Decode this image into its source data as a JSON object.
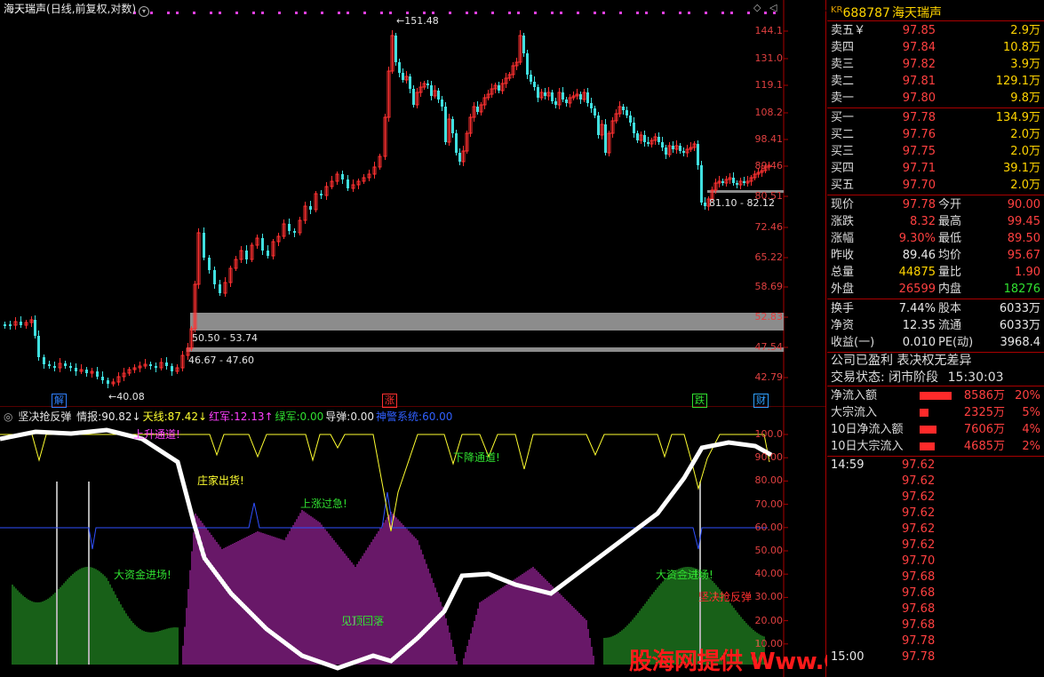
{
  "chart_header": {
    "stock_name": "海天瑞声",
    "mode": "(日线,前复权,对数)"
  },
  "price_axis": [
    "144.1",
    "131.0",
    "119.1",
    "108.2",
    "98.41",
    "89.46",
    "80.51",
    "72.46",
    "65.22",
    "58.69",
    "52.83",
    "47.54",
    "42.79"
  ],
  "price_annotations": {
    "high": "151.48",
    "low": "40.08",
    "zone_upper": "50.50 - 53.74",
    "zone_lower": "46.67 - 47.60",
    "gap_zone": "81.10 - 82.12"
  },
  "event_tags": [
    {
      "label": "解",
      "color": "#3080ff"
    },
    {
      "label": "涨",
      "color": "#ff3030"
    },
    {
      "label": "跌",
      "color": "#30e030"
    },
    {
      "label": "财",
      "color": "#30a0ff"
    }
  ],
  "indicator_header": {
    "name": "坚决抢反弹",
    "items": [
      {
        "label": "情报:",
        "value": "90.82",
        "arrow": "↓",
        "color": "#e8e8e8"
      },
      {
        "label": "天线:",
        "value": "87.42",
        "arrow": "↓",
        "color": "#ffff30"
      },
      {
        "label": "红军:",
        "value": "12.13",
        "arrow": "↑",
        "color": "#ff40ff"
      },
      {
        "label": "绿军:",
        "value": "0.00",
        "arrow": "",
        "color": "#30e030"
      },
      {
        "label": "导弹:",
        "value": "0.00",
        "arrow": "",
        "color": "#e8e8e8"
      },
      {
        "label": "神警系统:",
        "value": "60.00",
        "arrow": "",
        "color": "#3060ff"
      }
    ]
  },
  "indicator_axis": [
    "100.0",
    "90.00",
    "80.00",
    "70.00",
    "60.00",
    "50.00",
    "40.00",
    "30.00",
    "20.00",
    "10.00"
  ],
  "indicator_annotations": {
    "up_channel": "上升通道!",
    "dealer_out": "庄家出货!",
    "down_channel": "下降通道!",
    "rise_fast": "上涨过急!",
    "big_money_1": "大资金进场!",
    "big_money_2": "大资金进场!",
    "top_fall": "见顶回落",
    "rebound": "坚决抢反弹"
  },
  "watermark": "股海网提供 Www.Guhai.Com.CN",
  "panel": {
    "kr": "KR",
    "code": "688787",
    "name": "海天瑞声",
    "asks": [
      {
        "label": "卖五",
        "mark": "￥",
        "price": "97.85",
        "vol": "2.9",
        "unit": "万"
      },
      {
        "label": "卖四",
        "mark": "",
        "price": "97.84",
        "vol": "10.8",
        "unit": "万"
      },
      {
        "label": "卖三",
        "mark": "",
        "price": "97.82",
        "vol": "3.9",
        "unit": "万"
      },
      {
        "label": "卖二",
        "mark": "",
        "price": "97.81",
        "vol": "129.1",
        "unit": "万"
      },
      {
        "label": "卖一",
        "mark": "",
        "price": "97.80",
        "vol": "9.8",
        "unit": "万"
      }
    ],
    "bids": [
      {
        "label": "买一",
        "price": "97.78",
        "vol": "134.9",
        "unit": "万"
      },
      {
        "label": "买二",
        "price": "97.76",
        "vol": "2.0",
        "unit": "万"
      },
      {
        "label": "买三",
        "price": "97.75",
        "vol": "2.0",
        "unit": "万"
      },
      {
        "label": "买四",
        "price": "97.71",
        "vol": "39.1",
        "unit": "万"
      },
      {
        "label": "买五",
        "price": "97.70",
        "vol": "2.0",
        "unit": "万"
      }
    ],
    "quote": [
      {
        "l1": "现价",
        "v1": "97.78",
        "c1": "red",
        "l2": "今开",
        "v2": "90.00",
        "c2": "red"
      },
      {
        "l1": "涨跌",
        "v1": "8.32",
        "c1": "red",
        "l2": "最高",
        "v2": "99.45",
        "c2": "red"
      },
      {
        "l1": "涨幅",
        "v1": "9.30%",
        "c1": "red",
        "l2": "最低",
        "v2": "89.50",
        "c2": "red"
      },
      {
        "l1": "昨收",
        "v1": "89.46",
        "c1": "white",
        "l2": "均价",
        "v2": "95.67",
        "c2": "red"
      },
      {
        "l1": "总量",
        "v1": "44875",
        "c1": "yellow",
        "l2": "量比",
        "v2": "1.90",
        "c2": "red"
      },
      {
        "l1": "外盘",
        "v1": "26599",
        "c1": "red",
        "l2": "内盘",
        "v2": "18276",
        "c2": "green"
      }
    ],
    "quote2": [
      {
        "l1": "换手",
        "v1": "7.44%",
        "c1": "white",
        "l2": "股本",
        "v2": "6033万",
        "c2": "white"
      },
      {
        "l1": "净资",
        "v1": "12.35",
        "c1": "white",
        "l2": "流通",
        "v2": "6033万",
        "c2": "white"
      },
      {
        "l1": "收益(一)",
        "v1": "0.010",
        "c1": "white",
        "l2": "PE(动)",
        "v2": "3968.4",
        "c2": "white"
      }
    ],
    "notice": "公司已盈利 表决权无差异",
    "trade_status_label": "交易状态: 闭市阶段",
    "trade_status_time": "15:30:03",
    "flows": [
      {
        "label": "净流入额",
        "value": "8586万",
        "pct": "20%",
        "bar": 0.95
      },
      {
        "label": "大宗流入",
        "value": "2325万",
        "pct": "5%",
        "bar": 0.25
      },
      {
        "label": "10日净流入额",
        "value": "7606万",
        "pct": "4%",
        "bar": 0.5
      },
      {
        "label": "10日大宗流入",
        "value": "4685万",
        "pct": "2%",
        "bar": 0.45
      }
    ],
    "ticks": [
      {
        "time": "14:59",
        "price": "97.62"
      },
      {
        "time": "",
        "price": "97.62"
      },
      {
        "time": "",
        "price": "97.62"
      },
      {
        "time": "",
        "price": "97.62"
      },
      {
        "time": "",
        "price": "97.62"
      },
      {
        "time": "",
        "price": "97.62"
      },
      {
        "time": "",
        "price": "97.70"
      },
      {
        "time": "",
        "price": "97.68"
      },
      {
        "time": "",
        "price": "97.68"
      },
      {
        "time": "",
        "price": "97.68"
      },
      {
        "time": "",
        "price": "97.68"
      },
      {
        "time": "",
        "price": "97.78"
      },
      {
        "time": "15:00",
        "price": "97.78"
      }
    ]
  }
}
